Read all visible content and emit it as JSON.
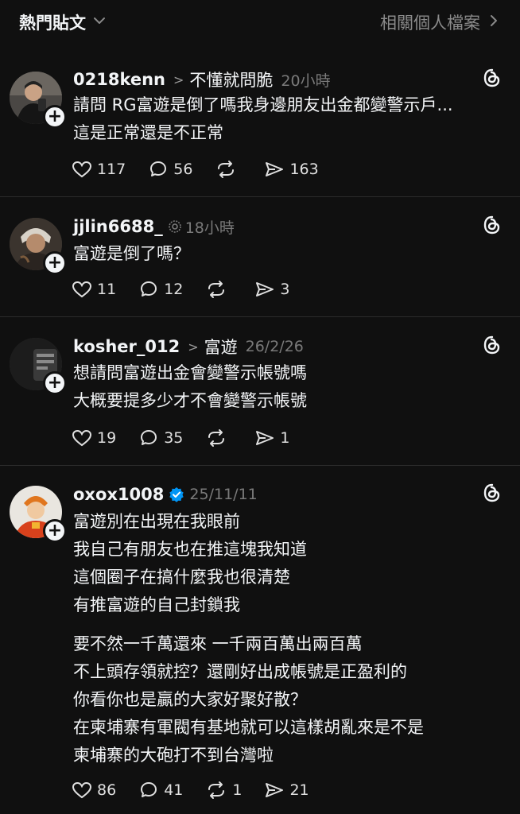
{
  "topbar": {
    "left_label": "熱門貼文",
    "right_label": "相關個人檔案"
  },
  "posts": [
    {
      "username": "0218kenn",
      "topic": "不懂就問脆",
      "time": "20小時",
      "lines": [
        "請問 RG富遊是倒了嗎我身邊朋友出金都變警示戶...",
        "這是正常還是不正常"
      ],
      "likes": "117",
      "replies": "56",
      "reposts": "",
      "shares": "163"
    },
    {
      "username": "jjlin6688_",
      "topic": "",
      "time": "18小時",
      "lines": [
        "富遊是倒了嗎？"
      ],
      "likes": "11",
      "replies": "12",
      "reposts": "",
      "shares": "3"
    },
    {
      "username": "kosher_012",
      "topic": "富遊",
      "time": "26/2/26",
      "lines": [
        "想請問富遊出金會變警示帳號嗎",
        "大概要提多少才不會變警示帳號"
      ],
      "likes": "19",
      "replies": "35",
      "reposts": "",
      "shares": "1"
    },
    {
      "username": "oxox1008",
      "topic": "",
      "time": "25/11/11",
      "lines": [
        "富遊別在出現在我眼前",
        "我自己有朋友也在推這塊我知道",
        "這個圈子在搞什麼我也很清楚",
        "有推富遊的自己封鎖我",
        "",
        "要不然一千萬還來 一千兩百萬出兩百萬",
        "不上頭存領就控？還剛好出成帳號是正盈利的",
        "你看你也是贏的大家好聚好散？",
        "在柬埔寨有軍閥有基地就可以這樣胡亂來是不是",
        "柬埔寨的大砲打不到台灣啦"
      ],
      "likes": "86",
      "replies": "41",
      "reposts": "1",
      "shares": "21"
    }
  ],
  "colors": {
    "background": "#101010",
    "text": "#f3f5f7",
    "muted": "#7a7a7a",
    "divider": "#2b2b2b",
    "verified": "#0095f6"
  }
}
